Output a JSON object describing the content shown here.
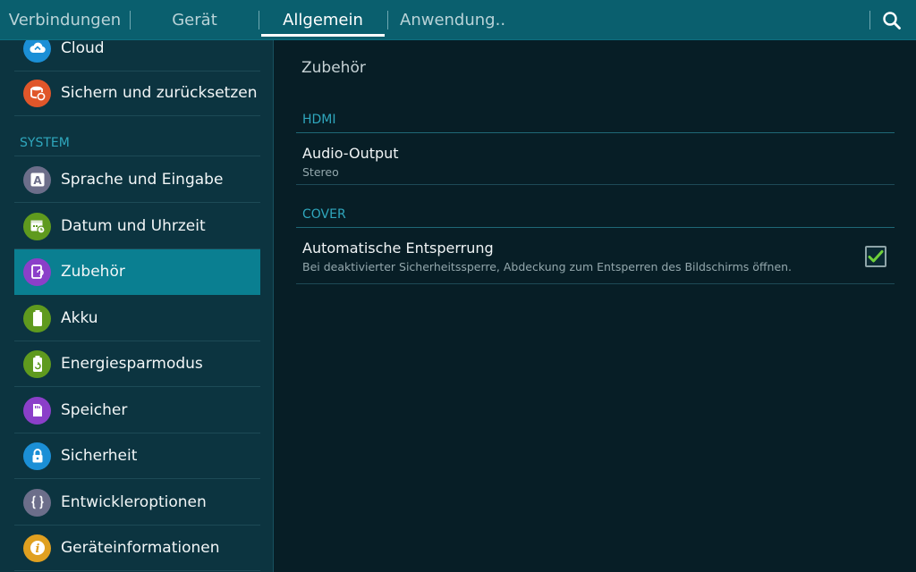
{
  "tabs": [
    {
      "label": "Verbindungen",
      "active": false
    },
    {
      "label": "Gerät",
      "active": false
    },
    {
      "label": "Allgemein",
      "active": true
    },
    {
      "label": "Anwendung..",
      "active": false
    }
  ],
  "colors": {
    "tab_bar": "#0a5f6e",
    "sidebar_bg": "#0c3440",
    "content_bg": "#071e26",
    "selected_item": "#0a7f91",
    "accent": "#2fa7bd",
    "check": "#6fd13a"
  },
  "sidebar": {
    "items_top": [
      {
        "label": "Cloud",
        "icon": "cloud-icon",
        "color": "#1b8fd6"
      },
      {
        "label": "Sichern und zurücksetzen",
        "icon": "backup-restore-icon",
        "color": "#e0562a"
      }
    ],
    "section_label": "SYSTEM",
    "items": [
      {
        "label": "Sprache und Eingabe",
        "icon": "language-icon",
        "color": "#6c6e8a"
      },
      {
        "label": "Datum und Uhrzeit",
        "icon": "calendar-clock-icon",
        "color": "#5f9a1e"
      },
      {
        "label": "Zubehör",
        "icon": "accessory-icon",
        "color": "#8b3fc9",
        "selected": true
      },
      {
        "label": "Akku",
        "icon": "battery-icon",
        "color": "#5f9a1e"
      },
      {
        "label": "Energiesparmodus",
        "icon": "power-saving-icon",
        "color": "#5f9a1e"
      },
      {
        "label": "Speicher",
        "icon": "storage-icon",
        "color": "#8b3fc9"
      },
      {
        "label": "Sicherheit",
        "icon": "lock-icon",
        "color": "#1b8fd6"
      },
      {
        "label": "Entwickleroptionen",
        "icon": "developer-braces-icon",
        "color": "#6c6e8a"
      },
      {
        "label": "Geräteinformationen",
        "icon": "info-icon",
        "color": "#e0a020"
      }
    ]
  },
  "content": {
    "title": "Zubehör",
    "hdmi_header": "HDMI",
    "audio_output": {
      "title": "Audio-Output",
      "summary": "Stereo"
    },
    "cover_header": "COVER",
    "auto_unlock": {
      "title": "Automatische Entsperrung",
      "summary": "Bei deaktivierter Sicherheitssperre, Abdeckung zum Entsperren des Bildschirms öffnen.",
      "checked": true
    }
  }
}
